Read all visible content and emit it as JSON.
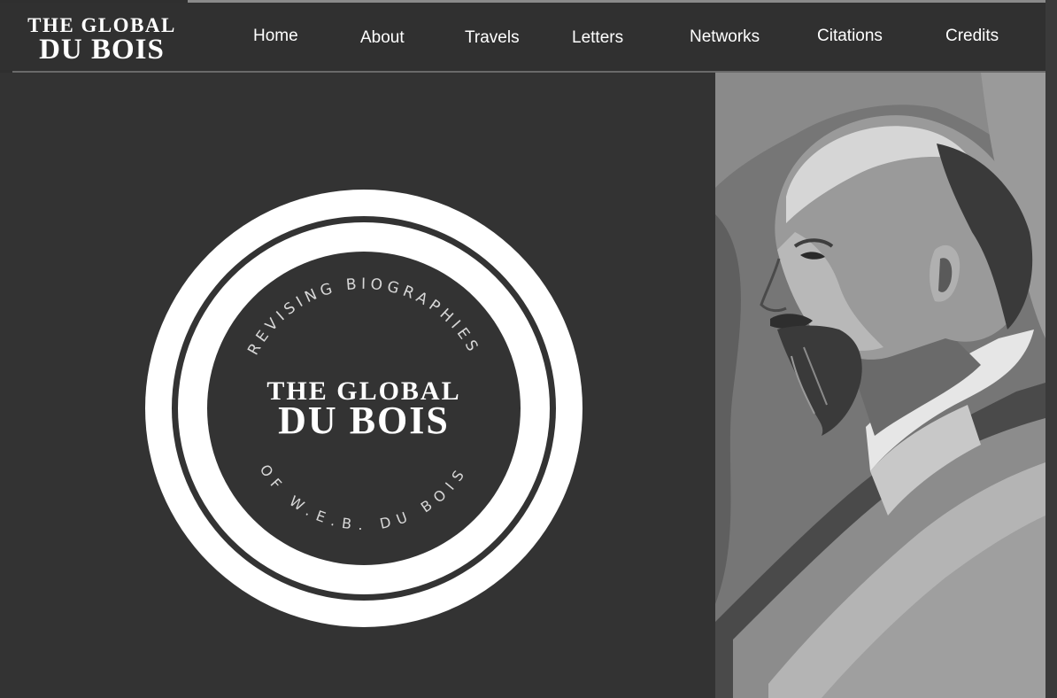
{
  "site": {
    "logo_line1": "THE GLOBAL",
    "logo_line2": "DU BOIS"
  },
  "nav": {
    "items": [
      {
        "label": "Home"
      },
      {
        "label": "About"
      },
      {
        "label": "Travels"
      },
      {
        "label": "Letters"
      },
      {
        "label": "Networks"
      },
      {
        "label": "Citations"
      },
      {
        "label": "Credits"
      }
    ]
  },
  "seal": {
    "arc_top": "REVISING BIOGRAPHIES",
    "arc_bottom": "OF W.E.B. DU BOIS",
    "title_line1": "THE GLOBAL",
    "title_line2": "DU BOIS"
  },
  "colors": {
    "background": "#333333",
    "text": "#ffffff",
    "header_rule": "#6a6a6a"
  }
}
